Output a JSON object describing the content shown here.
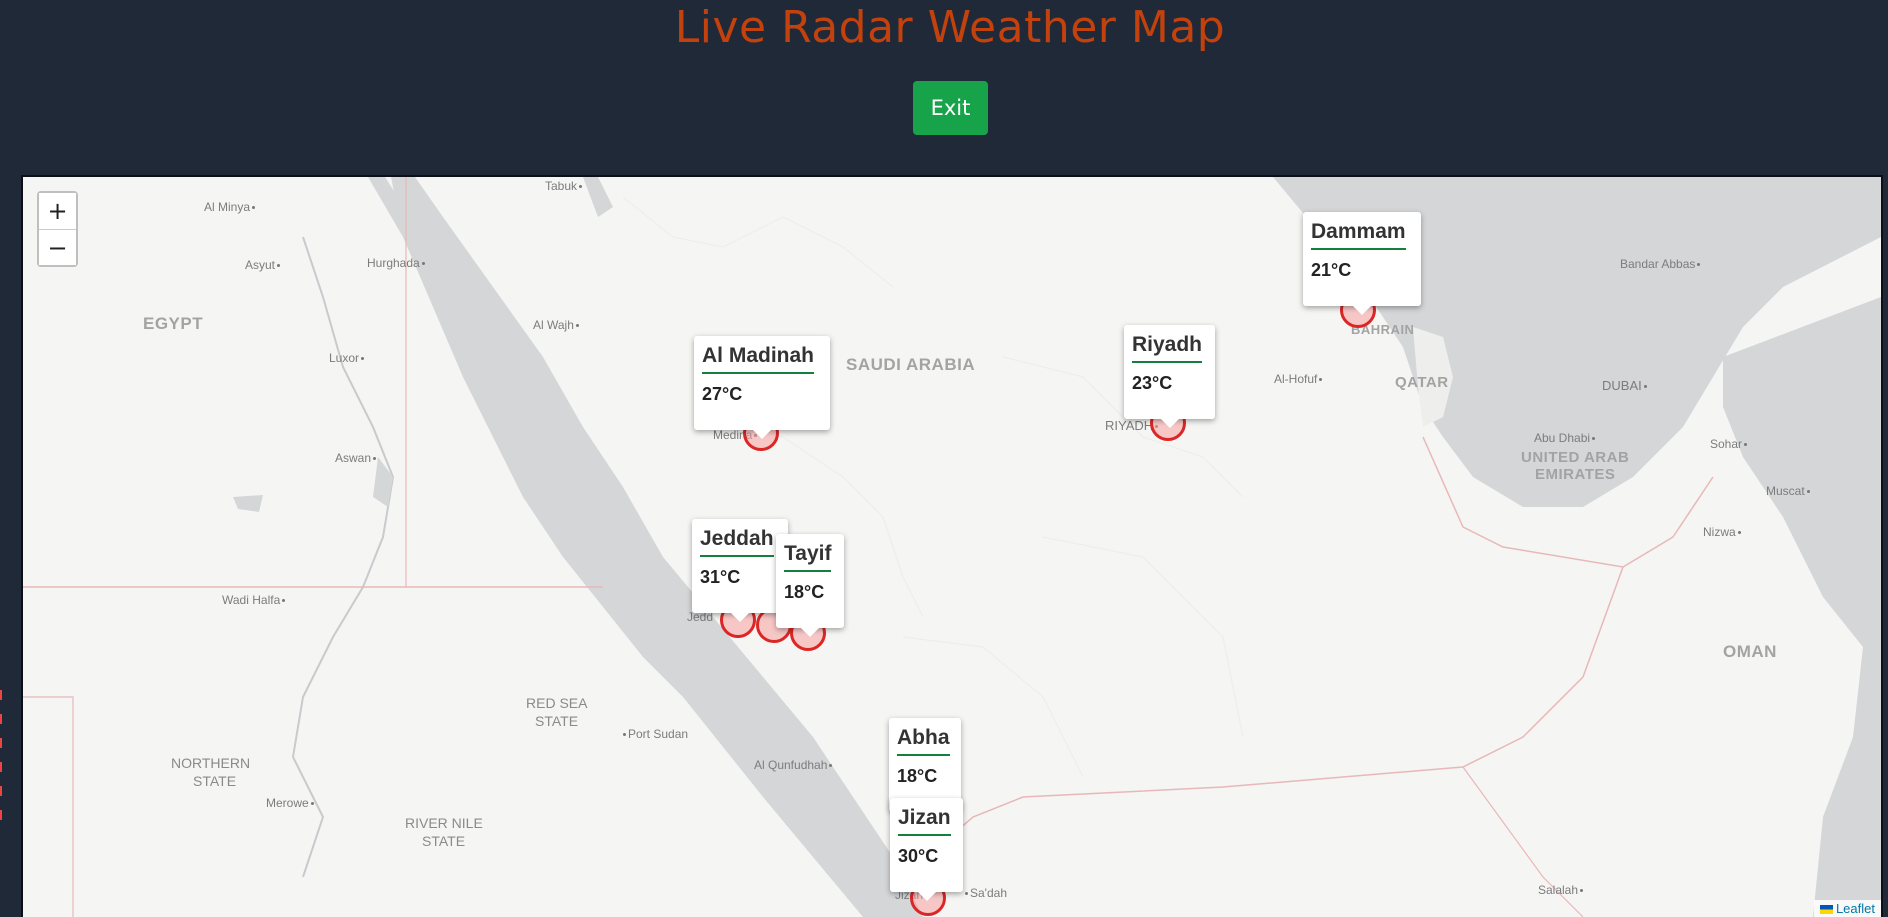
{
  "title": "Live Radar Weather Map",
  "exit_label": "Exit",
  "zoom": {
    "in": "+",
    "out": "−"
  },
  "attribution": "Leaflet",
  "countries": {
    "egypt": "EGYPT",
    "saudi": "SAUDI ARABIA",
    "qatar": "QATAR",
    "uae_1": "UNITED ARAB",
    "uae_2": "EMIRATES",
    "oman": "OMAN",
    "bahrain": "BAHRAIN"
  },
  "regions": {
    "red_sea_1": "RED SEA",
    "red_sea_2": "STATE",
    "northern_1": "NORTHERN",
    "northern_2": "STATE",
    "river_nile_1": "RIVER NILE",
    "river_nile_2": "STATE"
  },
  "places": {
    "tabuk": "Tabuk",
    "al_minya": "Al Minya",
    "asyut": "Asyut",
    "hurghada": "Hurghada",
    "luxor": "Luxor",
    "aswan": "Aswan",
    "al_wajh": "Al Wajh",
    "medina": "Medina",
    "riyadh": "RIYADH",
    "al_hofuf": "Al-Hofuf",
    "bandar_abbas": "Bandar Abbas",
    "dubai": "DUBAI",
    "abu_dhabi": "Abu Dhabi",
    "sohar": "Sohar",
    "muscat": "Muscat",
    "nizwa": "Nizwa",
    "wadi_halfa": "Wadi Halfa",
    "port_sudan": "Port Sudan",
    "al_qunfudhah": "Al Qunfudhah",
    "merowe": "Merowe",
    "jeddah": "Jedd",
    "jizan": "Jizan",
    "sadah": "Sa'dah",
    "salalah": "Salalah"
  },
  "stations": [
    {
      "name": "Dammam",
      "temp": "21°C"
    },
    {
      "name": "Riyadh",
      "temp": "23°C"
    },
    {
      "name": "Al Madinah",
      "temp": "27°C"
    },
    {
      "name": "Jeddah",
      "temp": "31°C"
    },
    {
      "name": "Tayif",
      "temp": "18°C"
    },
    {
      "name": "Abha",
      "temp": "18°C"
    },
    {
      "name": "Jizan",
      "temp": "30°C"
    }
  ],
  "colors": {
    "page_bg": "#1f2937",
    "title": "#c2410c",
    "exit_bg": "#16a34a",
    "sea": "#d4d6d8",
    "land": "#f5f5f3",
    "marker": "#dc2626",
    "popup_rule": "#15803d"
  }
}
